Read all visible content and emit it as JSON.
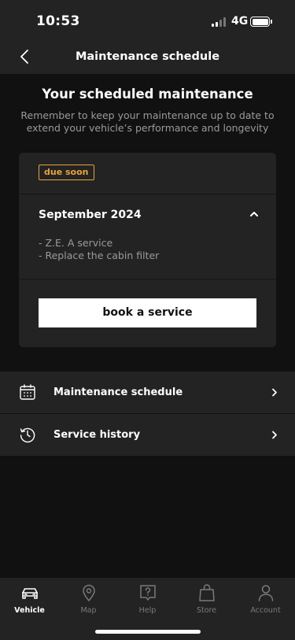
{
  "status_bar": {
    "time": "10:53",
    "network": "4G"
  },
  "nav": {
    "title": "Maintenance schedule"
  },
  "header": {
    "title": "Your scheduled maintenance",
    "subtitle": "Remember to keep your maintenance up to date to extend your vehicle’s performance and longevity"
  },
  "maintenance_card": {
    "badge": "due soon",
    "month": "September 2024",
    "services": [
      "- Z.E. A service",
      "- Replace the cabin filter"
    ],
    "book_label": "book a service",
    "badge_color": "#e8a33a"
  },
  "menu": [
    {
      "label": "Maintenance schedule",
      "icon": "calendar-icon"
    },
    {
      "label": "Service history",
      "icon": "history-icon"
    }
  ],
  "tabs": [
    {
      "label": "Vehicle",
      "icon": "car-icon",
      "active": true
    },
    {
      "label": "Map",
      "icon": "map-pin-icon",
      "active": false
    },
    {
      "label": "Help",
      "icon": "help-icon",
      "active": false
    },
    {
      "label": "Store",
      "icon": "shopping-bag-icon",
      "active": false
    },
    {
      "label": "Account",
      "icon": "account-icon",
      "active": false
    }
  ]
}
